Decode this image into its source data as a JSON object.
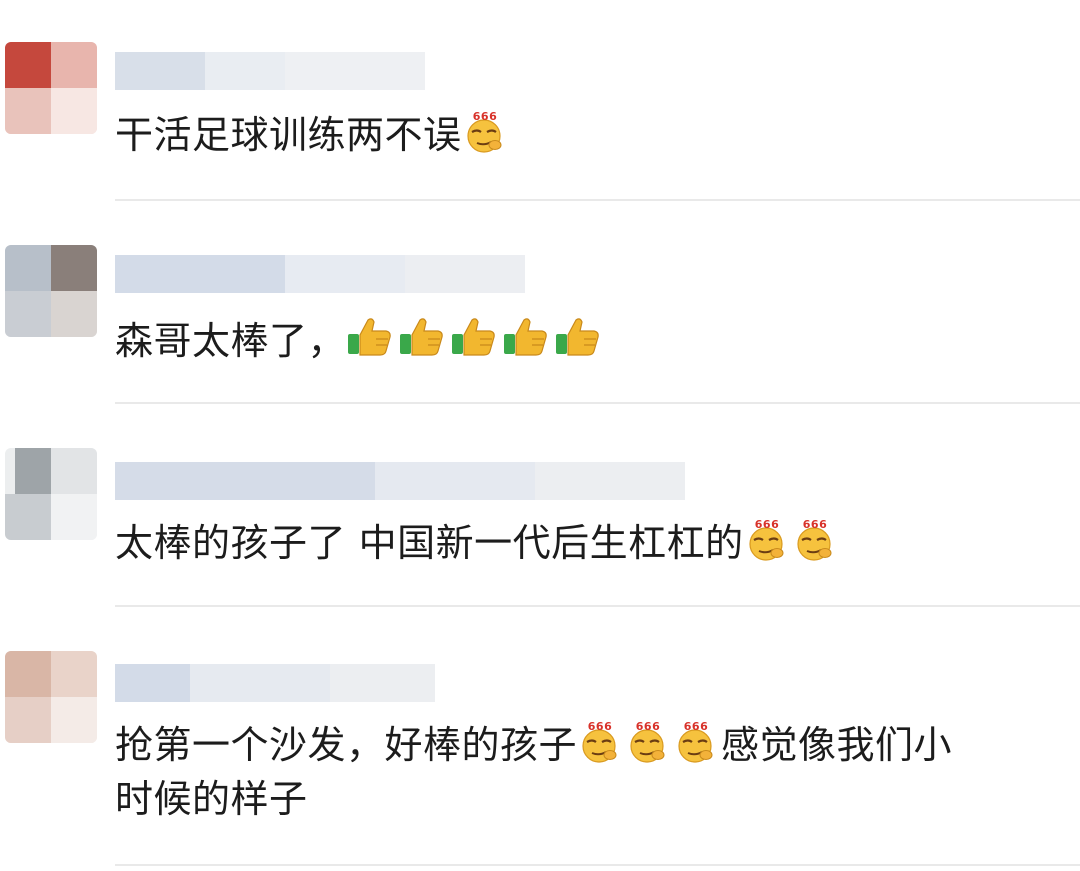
{
  "comments": [
    {
      "text_parts": [
        "干活足球训练两不误"
      ],
      "emojis_after": [
        "666-smug-emoji"
      ]
    },
    {
      "text_parts": [
        "森哥太棒了，"
      ],
      "emojis_after": [
        "thumbs-up-emoji",
        "thumbs-up-emoji",
        "thumbs-up-emoji",
        "thumbs-up-emoji",
        "thumbs-up-emoji"
      ]
    },
    {
      "text_parts": [
        "太棒的孩子了 中国新一代后生杠杠的"
      ],
      "emojis_after": [
        "666-smug-emoji",
        "666-smug-emoji"
      ]
    },
    {
      "text_before": "抢第一个沙发，好棒的孩子",
      "text_after_line1": "感觉像我们小",
      "text_line2": "时候的样子",
      "emojis_mid": [
        "666-smug-emoji",
        "666-smug-emoji",
        "666-smug-emoji"
      ]
    }
  ],
  "emoji_badge": "666",
  "colors": {
    "divider": "#e9e9e9",
    "emoji_face": "#f6c23e",
    "badge_red": "#d8322a",
    "thumb_green": "#3aa84a",
    "thumb_yellow": "#f2b72f"
  }
}
